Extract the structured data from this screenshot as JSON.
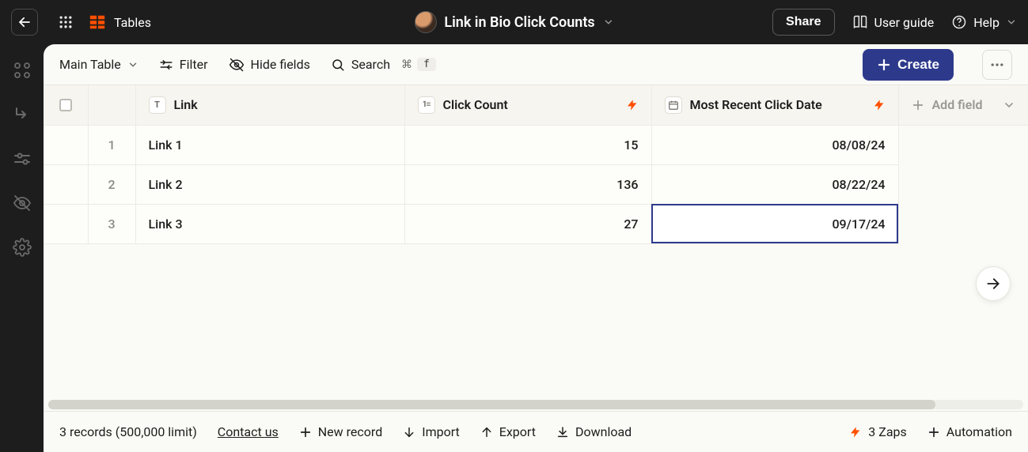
{
  "header": {
    "brand": "Tables",
    "title": "Link in Bio Click Counts",
    "share_label": "Share",
    "user_guide_label": "User guide",
    "help_label": "Help"
  },
  "toolbar": {
    "view_label": "Main Table",
    "filter_label": "Filter",
    "hide_fields_label": "Hide fields",
    "search_label": "Search",
    "search_shortcut_mod": "⌘",
    "search_shortcut_key": "f",
    "create_label": "Create"
  },
  "columns": {
    "link": {
      "label": "Link",
      "type_badge": "T"
    },
    "click_count": {
      "label": "Click Count",
      "type_badge": "1≡"
    },
    "date": {
      "label": "Most Recent Click Date"
    },
    "add_field": {
      "label": "Add field"
    }
  },
  "rows": [
    {
      "num": "1",
      "link": "Link 1",
      "count": "15",
      "date": "08/08/24"
    },
    {
      "num": "2",
      "link": "Link 2",
      "count": "136",
      "date": "08/22/24"
    },
    {
      "num": "3",
      "link": "Link 3",
      "count": "27",
      "date": "09/17/24"
    }
  ],
  "footer": {
    "records_label": "3 records (500,000 limit)",
    "contact_label": "Contact us",
    "new_record_label": "New record",
    "import_label": "Import",
    "export_label": "Export",
    "download_label": "Download",
    "zaps_label": "3 Zaps",
    "automation_label": "Automation"
  }
}
